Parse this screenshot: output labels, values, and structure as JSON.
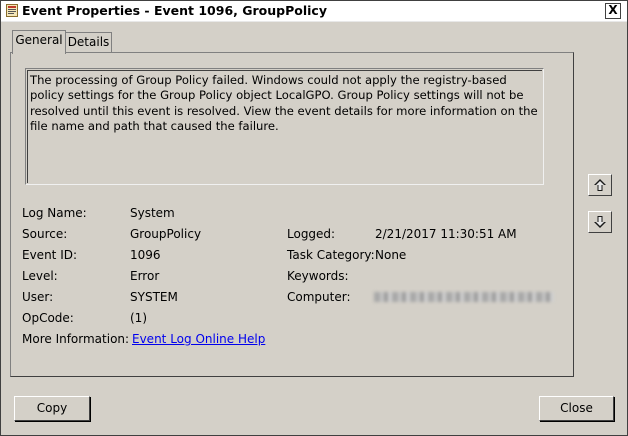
{
  "window": {
    "title": "Event Properties - Event 1096, GroupPolicy",
    "close_glyph": "X"
  },
  "tabs": [
    {
      "label": "General",
      "active": true
    },
    {
      "label": "Details",
      "active": false
    }
  ],
  "description": "The processing of Group Policy failed. Windows could not apply the registry-based policy settings for the Group Policy object LocalGPO. Group Policy settings will not be resolved until this event is resolved. View the event details for more information on the file name and path that caused the failure.",
  "fields": {
    "log_name": {
      "label": "Log Name:",
      "value": "System"
    },
    "source": {
      "label": "Source:",
      "value": "GroupPolicy"
    },
    "event_id": {
      "label": "Event ID:",
      "value": "1096"
    },
    "level": {
      "label": "Level:",
      "value": "Error"
    },
    "user": {
      "label": "User:",
      "value": "SYSTEM"
    },
    "opcode": {
      "label": "OpCode:",
      "value": "(1)"
    },
    "more_info": {
      "label": "More Information:",
      "value": "Event Log Online Help"
    },
    "logged": {
      "label": "Logged:",
      "value": "2/21/2017 11:30:51 AM"
    },
    "task_category": {
      "label": "Task Category:",
      "value": "None"
    },
    "keywords": {
      "label": "Keywords:",
      "value": ""
    },
    "computer": {
      "label": "Computer:",
      "value": ""
    }
  },
  "buttons": {
    "copy": "Copy",
    "close": "Close",
    "up_icon": "arrow-up-icon",
    "down_icon": "arrow-down-icon"
  }
}
